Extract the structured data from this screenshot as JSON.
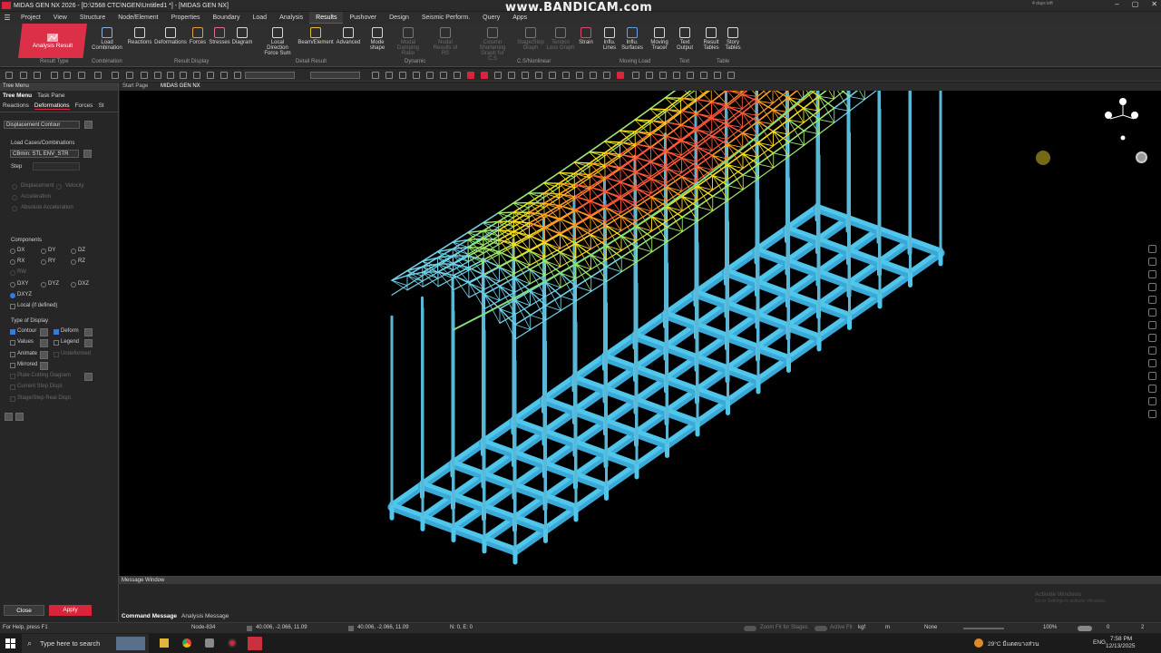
{
  "window": {
    "title": "MIDAS GEN NX 2026 - [D:\\2568 CTC\\NGEN\\Untitled1 *] - [MIDAS GEN NX]",
    "watermark": "www.BANDICAM.com",
    "trial": "4 days left"
  },
  "menu": [
    "Project",
    "View",
    "Structure",
    "Node/Element",
    "Properties",
    "Boundary",
    "Load",
    "Analysis",
    "Results",
    "Pushover",
    "Design",
    "Seismic Perform.",
    "Query",
    "Apps"
  ],
  "menu_active": "Results",
  "ribbon": {
    "analysis_result": "Analysis Result",
    "buttons": [
      {
        "label": "Load\nCombination",
        "icon": "load-combination-icon"
      },
      {
        "label": "Reactions",
        "icon": "reactions-icon"
      },
      {
        "label": "Deformations",
        "icon": "deformations-icon"
      },
      {
        "label": "Forces",
        "icon": "forces-icon"
      },
      {
        "label": "Stresses",
        "icon": "stresses-icon"
      },
      {
        "label": "Diagram",
        "icon": "diagram-icon"
      },
      {
        "label": "Local Direction\nForce Sum",
        "icon": "local-direction-icon"
      },
      {
        "label": "Beam/Element",
        "icon": "beam-element-icon"
      },
      {
        "label": "Advanced",
        "icon": "advanced-icon"
      },
      {
        "label": "Mode\nshape",
        "icon": "mode-shape-icon"
      },
      {
        "label": "Modal Damping\nRatio",
        "icon": "modal-damping-icon"
      },
      {
        "label": "Nodal\nResults of RS",
        "icon": "nodal-results-icon"
      },
      {
        "label": "Column Shortening\nGraph for C.S",
        "icon": "column-shortening-icon"
      },
      {
        "label": "Stage/Step\nGraph",
        "icon": "stage-step-icon"
      },
      {
        "label": "Tendon\nLoss Graph",
        "icon": "tendon-icon"
      },
      {
        "label": "Strain",
        "icon": "strain-icon"
      },
      {
        "label": "Influ.\nLines",
        "icon": "influence-lines-icon"
      },
      {
        "label": "Influ.\nSurfaces",
        "icon": "influence-surfaces-icon"
      },
      {
        "label": "Moving\nTracer",
        "icon": "moving-tracer-icon"
      },
      {
        "label": "Text\nOutput",
        "icon": "text-output-icon"
      },
      {
        "label": "Result\nTables",
        "icon": "result-tables-icon"
      },
      {
        "label": "Story\nTables",
        "icon": "story-tables-icon"
      }
    ],
    "groups": [
      "Result Type",
      "Combination",
      "Result Display",
      "Detail Result",
      "Dynamic",
      "C.S/Nonlinear",
      "Moving Load",
      "Text",
      "Table"
    ]
  },
  "panel": {
    "header": "Tree Menu",
    "tabs": [
      "Tree Menu",
      "Task Pane"
    ],
    "subtabs": [
      "Reactions",
      "Deformations",
      "Forces",
      "St"
    ],
    "subtab_active": "Deformations",
    "display_mode": "Displacement Contour",
    "load_cases_label": "Load Cases/Combinations",
    "load_case": "CBmin: STL ENV_STR",
    "step_label": "Step",
    "step_value": "",
    "disp_options": [
      "Displacement",
      "Velocity",
      "Acceleration",
      "Absolute Acceleration"
    ],
    "components_label": "Components",
    "components": [
      "DX",
      "DY",
      "DZ",
      "RX",
      "RY",
      "RZ",
      "RW",
      "DXY",
      "DYZ",
      "DXZ",
      "DXYZ"
    ],
    "component_selected": "DXYZ",
    "local": "Local (if defined)",
    "type_label": "Type of Display",
    "type_options": [
      "Contour",
      "Deform",
      "Values",
      "Legend",
      "Animate",
      "Undeformed",
      "Mirrored",
      "Plate Cutting Diagram",
      "Current Step Displ.",
      "Stage/Step Real Displ."
    ],
    "close": "Close",
    "apply": "Apply"
  },
  "viewport": {
    "tabs": [
      "Start Page",
      "MIDAS GEN NX"
    ],
    "accent": "#d9243a"
  },
  "message": {
    "title": "Message Window",
    "tabs": [
      "Command Message",
      "Analysis Message"
    ],
    "activate": "Activate Windows",
    "activate_sub": "Go to Settings to activate Windows."
  },
  "status": {
    "help": "For Help, press F1",
    "node": "Node-834",
    "coord1": "40.006, -2.066, 11.09",
    "coord2": "40.006, -2.066, 11.09",
    "ne": "N: 0, E: 0",
    "zoom_fit": "Zoom Fit for Stages",
    "active_fit": "Active Fit",
    "force_unit": "kgf",
    "length_unit": "m",
    "none": "None",
    "zoom": "100%",
    "page_cur": "0",
    "page_tot": "2"
  },
  "taskbar": {
    "search": "Type here to search",
    "temp": "29°C มีแดดบางส่วน",
    "lang": "ENG",
    "time": "7:58 PM",
    "date": "12/13/2025"
  }
}
